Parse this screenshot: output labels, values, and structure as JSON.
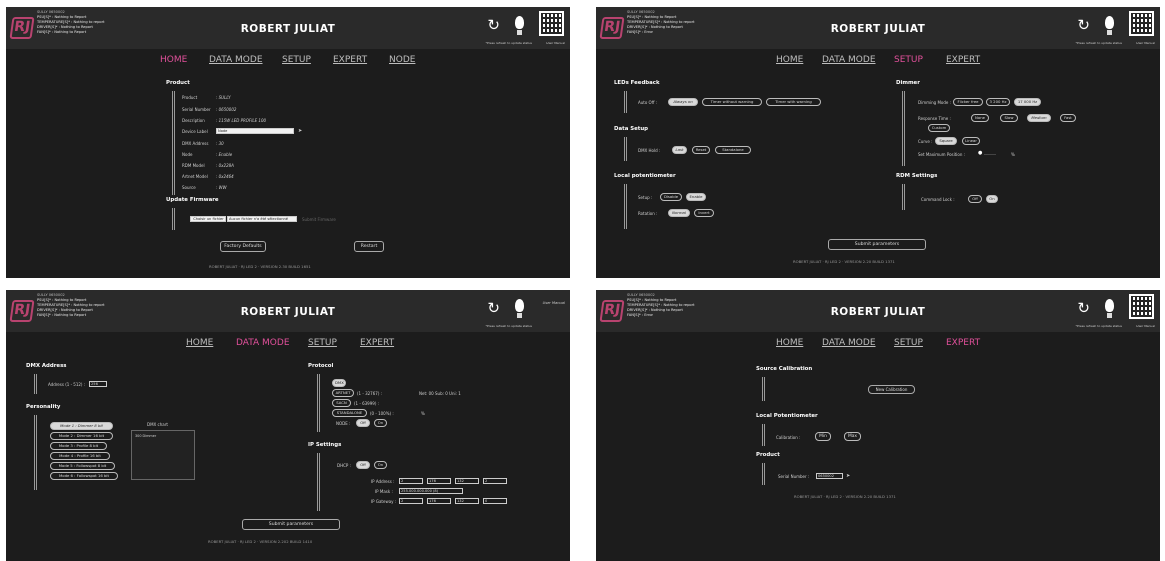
{
  "brand": "ROBERT JULIAT",
  "refresh_hint": "*Press refresh to update status",
  "manual_label": "User Manual",
  "panels": {
    "home": {
      "status": [
        "SULLY 0650002",
        "PSU[S]* : Nothing to Report",
        "TEMPERATURE[S]* : Nothing to report",
        "DRIVER[S]* : Nothing to Report",
        "FAN[S]* : Nothing to Report"
      ],
      "nav": [
        "HOME",
        "DATA MODE",
        "SETUP",
        "EXPERT",
        "NODE"
      ],
      "product_title": "Product",
      "rows": [
        {
          "label": "Product",
          "value": ": SULLY"
        },
        {
          "label": "Serial Number",
          "value": ": 0650002"
        },
        {
          "label": "Description",
          "value": ": 115W LED PROFILE 100"
        },
        {
          "label": "Device Label",
          "value": "Node"
        },
        {
          "label": "DMX Address",
          "value": ": 30"
        },
        {
          "label": "Node",
          "value": ": Enable"
        },
        {
          "label": "RDM Model",
          "value": ": 0x228A"
        },
        {
          "label": "Artnet Model",
          "value": ": 0x2464"
        },
        {
          "label": "Source",
          "value": ": WW"
        }
      ],
      "firmware_title": "Update Firmware",
      "choose_file": "Choisir un fichier",
      "no_file": "Aucun fichier n'a été sélectionné",
      "submit_firmware": "Submit Firmware",
      "factory_defaults": "Factory Defaults",
      "restart": "Restart",
      "footer": "ROBERT JULIAT  ·  RJ LED 2  ·  VERSION 2.30 BUILD 1651"
    },
    "setup": {
      "status": [
        "SULLY 0650002",
        "PSU[S]* : Nothing to Report",
        "TEMPERATURE[S]* : Nothing to report",
        "DRIVER[S]* : Nothing to Report",
        "FAN[S]* : Error"
      ],
      "nav": [
        "HOME",
        "DATA MODE",
        "SETUP",
        "EXPERT"
      ],
      "leds_title": "LEDs Feedback",
      "auto_off_label": "Auto Off :",
      "auto_off_opts": [
        "Always on",
        "Timer without warning",
        "Timer with warning"
      ],
      "data_setup_title": "Data Setup",
      "dmx_hold_label": "DMX Hold :",
      "dmx_hold_opts": [
        "Last",
        "Reset",
        "Standalone"
      ],
      "local_pot_title": "Local potentiometer",
      "setup_label": "Setup :",
      "setup_opts": [
        "Disable",
        "Enable"
      ],
      "rotation_label": "Rotation :",
      "rotation_opts": [
        "Normal",
        "Invert"
      ],
      "dimmer_title": "Dimmer",
      "dimming_mode_label": "Dimming Mode :",
      "dimming_mode_opts": [
        "Flicker free",
        "3 200 Hz",
        "17 000 Hz"
      ],
      "response_label": "Response Time :",
      "response_opts": [
        "None",
        "Slow",
        "Medium",
        "Fast",
        "Custom"
      ],
      "curve_label": "Curve :",
      "curve_opts": [
        "Square",
        "Linear"
      ],
      "max_pos_label": "Set Maximum Position :",
      "max_pos_unit": "%",
      "rdm_title": "RDM Settings",
      "lock_label": "Command Lock :",
      "lock_opts": [
        "Off",
        "On"
      ],
      "submit": "Submit parameters",
      "footer": "ROBERT JULIAT  ·  RJ LED 2  ·  VERSION 2.20 BUILD 1371"
    },
    "data": {
      "status": [
        "SULLY 0650002",
        "PSU[S]* : Nothing to Report",
        "TEMPERATURE[S]* : Nothing to report",
        "DRIVER[S]* : Nothing to Report",
        "FAN[S]* : Nothing to Report"
      ],
      "nav": [
        "HOME",
        "DATA MODE",
        "SETUP",
        "EXPERT"
      ],
      "dmx_title": "DMX Address",
      "address_label": "Address (1 - 512) :",
      "address_value": "256",
      "personality_title": "Personality",
      "modes": [
        "Mode 1 : Dimmer 8 bit",
        "Mode 2 : Dimmer 16 bit",
        "Mode 3 : Profile 8 bit",
        "Mode 4 : Profile 16 bit",
        "Mode 5 : Followspot 8 bit",
        "Mode 6 : Followspot 16 bit"
      ],
      "dmx_chart_label": "DMX chart",
      "dmx_chart_row": "300 Dimmer",
      "protocol_title": "Protocol",
      "protocols": [
        {
          "name": "DMX",
          "info": ""
        },
        {
          "name": "ARTNET",
          "info": "(1 - 32767) :",
          "extra": "Net: 00 Sub: 0 Uni: 1"
        },
        {
          "name": "SACN",
          "info": "(1 - 63999) :"
        },
        {
          "name": "STANDALONE",
          "info": "(0 - 100%) :",
          "extra": "%"
        }
      ],
      "node_label": "NODE :",
      "node_opts": [
        "Off",
        "On"
      ],
      "ip_title": "IP Settings",
      "dhcp_label": "DHCP :",
      "dhcp_opts": [
        "Off",
        "On"
      ],
      "ip_address_label": "IP Address :",
      "ip_address": [
        "2",
        "176",
        "132",
        "2"
      ],
      "ip_mask_label": "IP Mask :",
      "ip_mask": "255.000.000.000 (8)",
      "ip_gateway_label": "IP Gateway :",
      "ip_gateway": [
        "2",
        "176",
        "132",
        "0"
      ],
      "submit": "Submit parameters",
      "footer": "ROBERT JULIAT  ·  RJ LED 2  ·  VERSION 2.202 BUILD 1410"
    },
    "expert": {
      "status": [
        "SULLY 0650002",
        "PSU[S]* : Nothing to Report",
        "TEMPERATURE[S]* : Nothing to report",
        "DRIVER[S]* : Nothing to Report",
        "FAN[S]* : Error"
      ],
      "nav": [
        "HOME",
        "DATA MODE",
        "SETUP",
        "EXPERT"
      ],
      "source_title": "Source Calibration",
      "new_calibration": "New Calibration",
      "local_pot_title": "Local Potentiometer",
      "calibration_label": "Calibration :",
      "min": "Min",
      "max": "Max",
      "product_title": "Product",
      "serial_label": "Serial Number :",
      "serial_value": "0650002",
      "footer": "ROBERT JULIAT  ·  RJ LED 2  ·  VERSION 2.20 BUILD 1371"
    }
  }
}
